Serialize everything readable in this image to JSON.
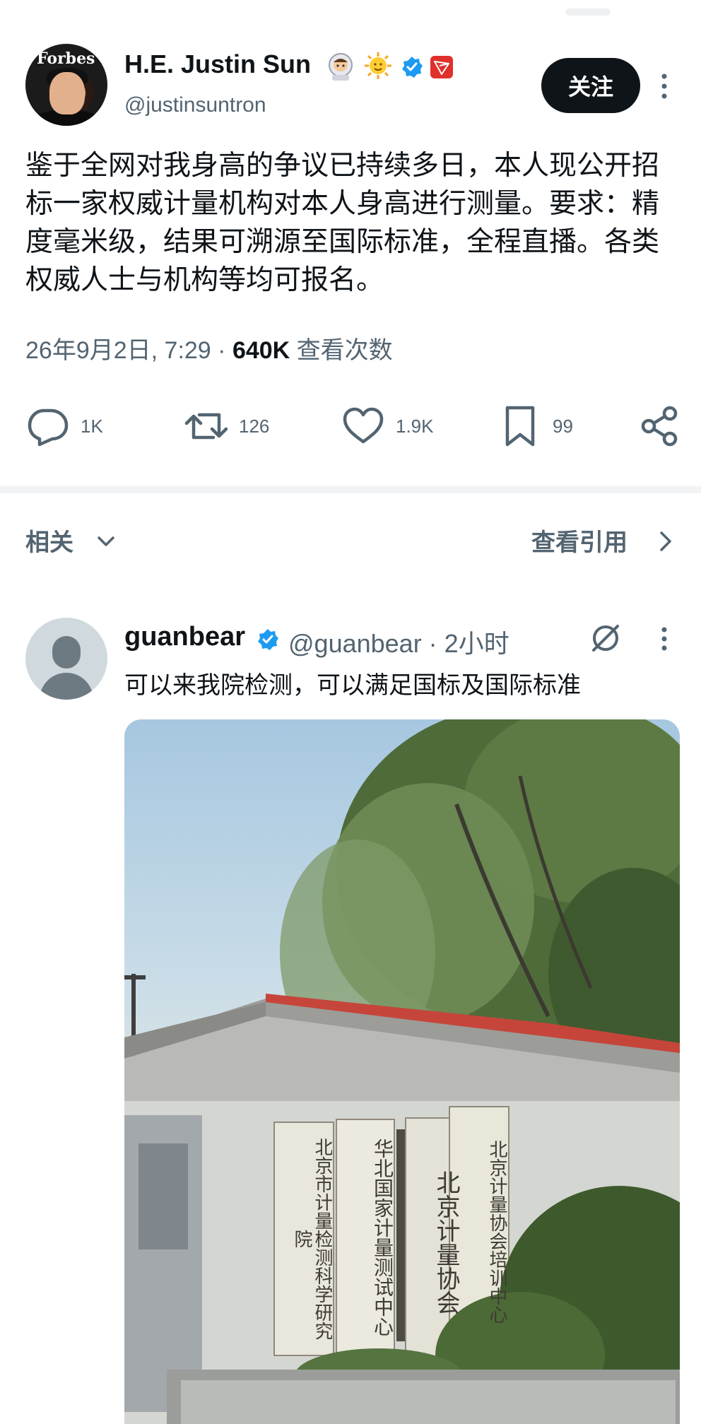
{
  "tweet": {
    "avatar_text": "Forbes",
    "display_name": "H.E. Justin Sun",
    "handle": "@justinsuntron",
    "follow_label": "关注",
    "text": "鉴于全网对我身高的争议已持续多日，本人现公开招标一家权威计量机构对本人身高进行测量。要求：精度毫米级，结果可溯源至国际标准，全程直播。各类权威人士与机构等均可报名。",
    "timestamp": "26年9月2日, 7:29",
    "separator": "·",
    "views_count": "640K",
    "views_label": "查看次数",
    "badges": [
      "astronaut-emoji",
      "sun-emoji",
      "verified-badge",
      "tron-badge"
    ],
    "colors": {
      "verified": "#1d9bf0",
      "tron": "#e0302b",
      "follow_bg": "#0f1419"
    }
  },
  "actions": {
    "reply_count": "1K",
    "retweet_count": "126",
    "like_count": "1.9K",
    "bookmark_count": "99"
  },
  "related": {
    "label": "相关",
    "quotes_label": "查看引用"
  },
  "reply": {
    "name": "guanbear",
    "handle_time": "@guanbear · 2小时",
    "text": "可以来我院检测，可以满足国标及国际标准",
    "photo": {
      "sign1": "北京市计量检测科学研究院",
      "sign2": "华北国家计量测试中心",
      "sign3": "北京计量协会",
      "sign4": "北京计量协会培训中心"
    }
  }
}
